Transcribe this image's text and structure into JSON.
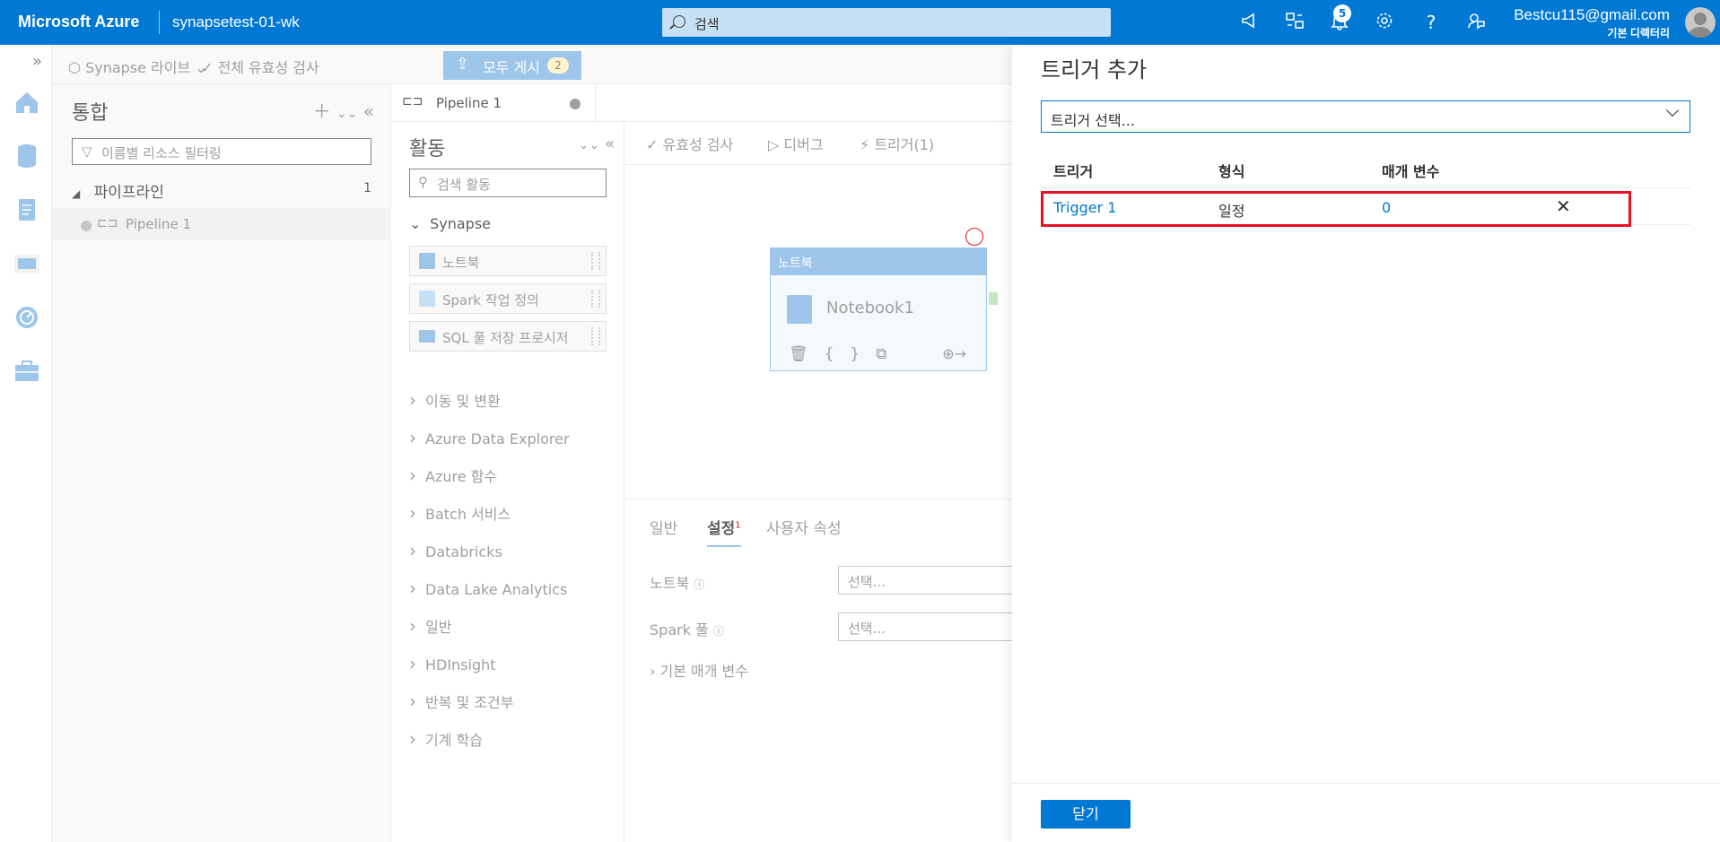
{
  "topbar": {
    "brand": "Microsoft Azure",
    "workspace": "synapsetest-01-wk",
    "search_placeholder": "검색",
    "notification_count": "5",
    "user_email": "Bestcu115@gmail.com",
    "user_directory": "기본 디렉터리",
    "icons": [
      "announcement-icon",
      "portal-switch-icon",
      "bell-icon",
      "gear-icon",
      "help-icon",
      "feedback-icon"
    ]
  },
  "cmdbar": {
    "synapse_live": "Synapse 라이브",
    "validate_all": "전체 유효성 검사",
    "publish_all": "모두 게시",
    "publish_count": "2"
  },
  "integrate": {
    "title": "통합",
    "filter_placeholder": "이름별 리소스 필터링",
    "group_label": "파이프라인",
    "group_count": "1",
    "pipeline_item": "Pipeline 1"
  },
  "editor": {
    "tab_label": "Pipeline 1",
    "activities_title": "활동",
    "search_placeholder": "검색 활동",
    "synapse_group": "Synapse",
    "synapse_items": [
      "노트북",
      "Spark 작업 정의",
      "SQL 풀 저장 프로시저"
    ],
    "categories": [
      "이동 및 변환",
      "Azure Data Explorer",
      "Azure 함수",
      "Batch 서비스",
      "Databricks",
      "Data Lake Analytics",
      "일반",
      "HDInsight",
      "반복 및 조건부",
      "기계 학습"
    ],
    "toolbar": {
      "validate": "유효성 검사",
      "debug": "디버그",
      "trigger": "트리거(1)"
    },
    "node": {
      "header": "노트북",
      "name": "Notebook1"
    },
    "prop_tabs": {
      "general": "일반",
      "settings": "설정",
      "settings_badge": "1",
      "user_props": "사용자 속성"
    },
    "props": {
      "notebook_label": "노트북",
      "notebook_placeholder": "선택...",
      "spark_label": "Spark 풀",
      "spark_placeholder": "선택...",
      "base_params": "기본 매개 변수"
    }
  },
  "trigger_panel": {
    "title": "트리거 추가",
    "dropdown": "트리거 선택...",
    "columns": [
      "트리거",
      "형식",
      "매개 변수"
    ],
    "rows": [
      {
        "name": "Trigger 1",
        "type": "일정",
        "params": "0"
      }
    ],
    "close_button": "닫기"
  },
  "colors": {
    "azure_blue": "#0078d4",
    "highlight_red": "#e81123"
  }
}
